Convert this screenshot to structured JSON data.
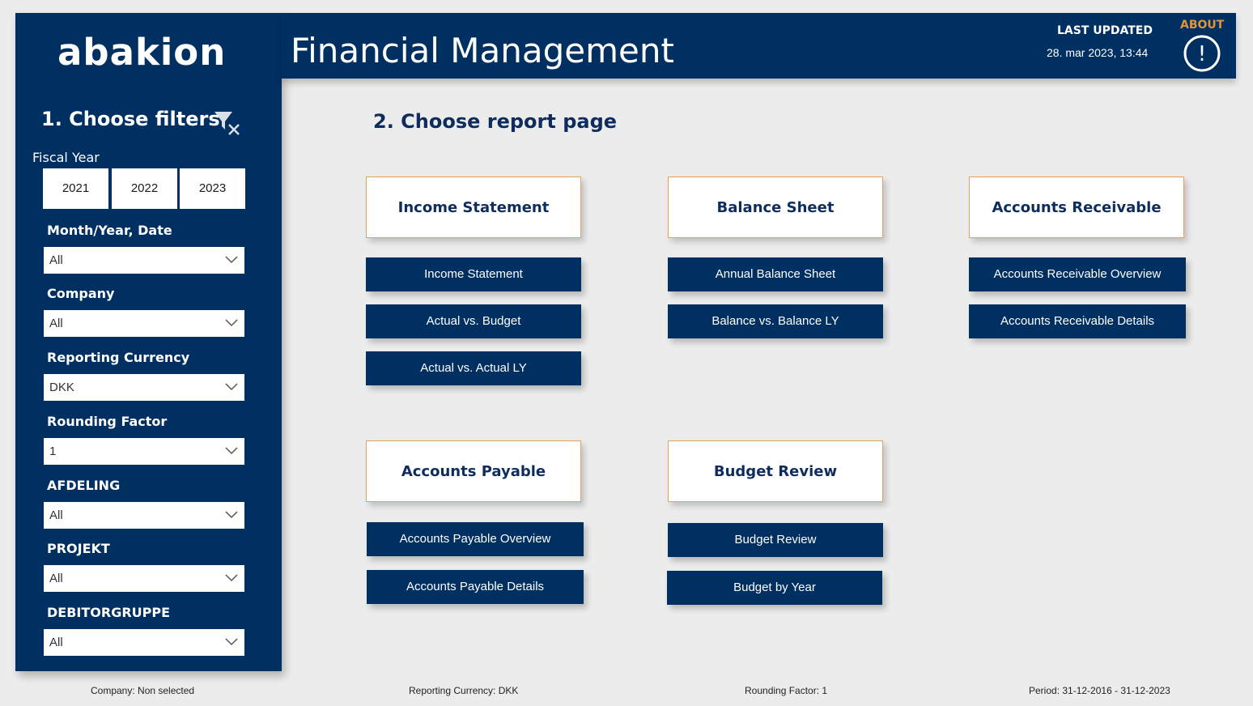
{
  "sidebar": {
    "logo": "abakion",
    "filters_title": "1. Choose filters",
    "fiscal_year": {
      "label": "Fiscal Year",
      "options": [
        "2021",
        "2022",
        "2023"
      ]
    },
    "filters": [
      {
        "label": "Month/Year, Date",
        "value": "All"
      },
      {
        "label": "Company",
        "value": "All"
      },
      {
        "label": "Reporting Currency",
        "value": "DKK"
      },
      {
        "label": "Rounding Factor",
        "value": "1"
      },
      {
        "label": "AFDELING",
        "value": "All"
      },
      {
        "label": "PROJEKT",
        "value": "All"
      },
      {
        "label": "DEBITORGRUPPE",
        "value": "All"
      }
    ]
  },
  "header": {
    "title": "Financial Management",
    "last_updated_label": "LAST UPDATED",
    "last_updated_value": "28. mar 2023, 13:44",
    "about_label": "ABOUT",
    "about_icon_glyph": "!"
  },
  "main": {
    "title": "2. Choose report page",
    "sections": [
      {
        "title": "Income Statement",
        "pages": [
          "Income Statement",
          "Actual vs. Budget",
          "Actual vs. Actual LY"
        ]
      },
      {
        "title": "Balance Sheet",
        "pages": [
          "Annual Balance Sheet",
          "Balance vs. Balance LY"
        ]
      },
      {
        "title": "Accounts Receivable",
        "pages": [
          "Accounts Receivable Overview",
          "Accounts Receivable Details"
        ]
      },
      {
        "title": "Accounts Payable",
        "pages": [
          "Accounts Payable Overview",
          "Accounts Payable Details"
        ]
      },
      {
        "title": "Budget Review",
        "pages": [
          "Budget Review",
          "Budget by Year"
        ]
      }
    ]
  },
  "footer": {
    "company": "Company: Non selected",
    "currency": "Reporting Currency: DKK",
    "rounding": "Rounding Factor: 1",
    "period": "Period: 31-12-2016 - 31-12-2023"
  },
  "colors": {
    "navy": "#002f62",
    "accent_orange": "#e0953a",
    "background": "#ececec"
  }
}
